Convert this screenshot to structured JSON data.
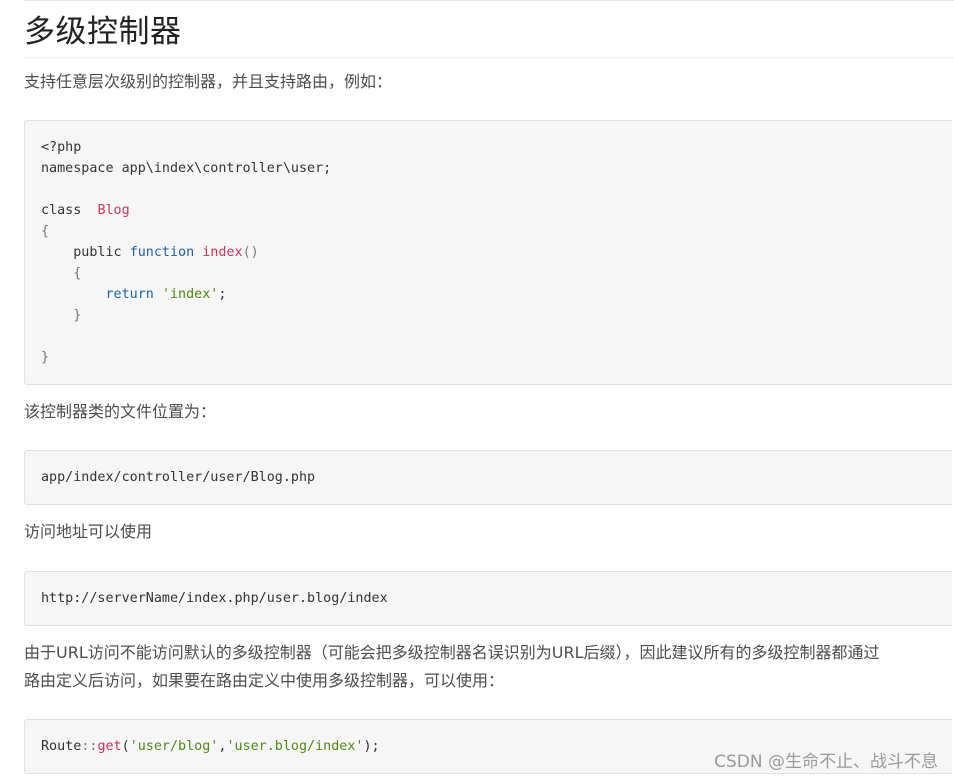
{
  "article": {
    "heading": "多级控制器",
    "intro": "支持任意层次级别的控制器，并且支持路由，例如：",
    "code1": {
      "l1": "<?php",
      "l2": "namespace app\\index\\controller\\user;",
      "l4_kw": "class",
      "l4_name": "Blog",
      "l5": "{",
      "l6_kw": "public",
      "l6_fn_kw": "function",
      "l6_name": "index",
      "l6_paren": "()",
      "l7": "{",
      "l8_kw": "return",
      "l8_str": "'index'",
      "l8_end": ";",
      "l9": "}",
      "l11": "}"
    },
    "file_location_text": "该控制器类的文件位置为：",
    "code2": "app/index/controller/user/Blog.php",
    "access_text": "访问地址可以使用",
    "code3": "http://serverName/index.php/user.blog/index",
    "note_line1": "由于URL访问不能访问默认的多级控制器（可能会把多级控制器名误识别为URL后缀），因此建议所有的多级控制器都通过",
    "note_line2": "路由定义后访问，如果要在路由定义中使用多级控制器，可以使用：",
    "code4": {
      "class": "Route",
      "sep": "::",
      "method": "get",
      "open": "(",
      "arg1": "'user/blog'",
      "comma": ",",
      "arg2": "'user.blog/index'",
      "close": ");"
    }
  },
  "watermark": "CSDN @生命不止、战斗不息"
}
